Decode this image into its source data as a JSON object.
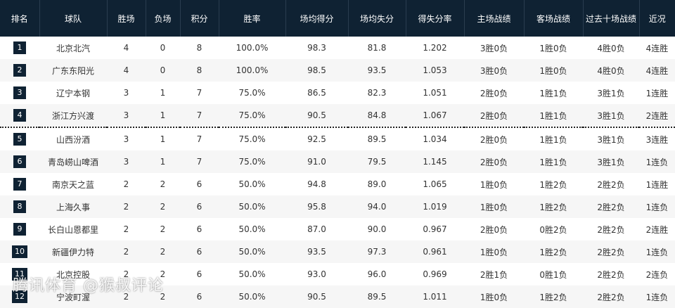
{
  "headers": [
    "排名",
    "球队",
    "胜场",
    "负场",
    "积分",
    "胜率",
    "场均得分",
    "场均失分",
    "得失分率",
    "主场战绩",
    "客场战绩",
    "过去十场战绩",
    "近况"
  ],
  "rows": [
    [
      "1",
      "北京北汽",
      "4",
      "0",
      "8",
      "100.0%",
      "98.3",
      "81.8",
      "1.202",
      "3胜0负",
      "1胜0负",
      "4胜0负",
      "4连胜"
    ],
    [
      "2",
      "广东东阳光",
      "4",
      "0",
      "8",
      "100.0%",
      "98.5",
      "93.5",
      "1.053",
      "3胜0负",
      "1胜0负",
      "4胜0负",
      "4连胜"
    ],
    [
      "3",
      "辽宁本钢",
      "3",
      "1",
      "7",
      "75.0%",
      "86.5",
      "82.3",
      "1.051",
      "2胜0负",
      "1胜1负",
      "3胜1负",
      "1连胜"
    ],
    [
      "4",
      "浙江方兴渡",
      "3",
      "1",
      "7",
      "75.0%",
      "90.5",
      "84.8",
      "1.067",
      "2胜0负",
      "1胜1负",
      "3胜1负",
      "2连胜"
    ],
    [
      "5",
      "山西汾酒",
      "3",
      "1",
      "7",
      "75.0%",
      "92.5",
      "89.5",
      "1.034",
      "2胜0负",
      "1胜1负",
      "3胜1负",
      "3连胜"
    ],
    [
      "6",
      "青岛崂山啤酒",
      "3",
      "1",
      "7",
      "75.0%",
      "91.0",
      "79.5",
      "1.145",
      "2胜0负",
      "1胜1负",
      "3胜1负",
      "1连负"
    ],
    [
      "7",
      "南京天之蓝",
      "2",
      "2",
      "6",
      "50.0%",
      "94.8",
      "89.0",
      "1.065",
      "1胜0负",
      "1胜2负",
      "2胜2负",
      "1连胜"
    ],
    [
      "8",
      "上海久事",
      "2",
      "2",
      "6",
      "50.0%",
      "95.8",
      "94.0",
      "1.019",
      "1胜0负",
      "1胜2负",
      "2胜2负",
      "1连负"
    ],
    [
      "9",
      "长白山恩都里",
      "2",
      "2",
      "6",
      "50.0%",
      "87.0",
      "90.0",
      "0.967",
      "2胜0负",
      "0胜2负",
      "2胜2负",
      "2连胜"
    ],
    [
      "10",
      "新疆伊力特",
      "2",
      "2",
      "6",
      "50.0%",
      "93.5",
      "97.3",
      "0.961",
      "1胜0负",
      "1胜2负",
      "2胜2负",
      "1连负"
    ],
    [
      "11",
      "北京控股",
      "2",
      "2",
      "6",
      "50.0%",
      "93.0",
      "96.0",
      "0.969",
      "2胜1负",
      "0胜1负",
      "2胜2负",
      "2连负"
    ],
    [
      "12",
      "宁波町渥",
      "2",
      "2",
      "6",
      "50.0%",
      "90.5",
      "89.5",
      "1.011",
      "1胜0负",
      "1胜2负",
      "2胜2负",
      "1连负"
    ]
  ],
  "watermark": "腾讯体育 @猴叔评论",
  "colors": {
    "header_bg": "#0f2233",
    "badge_bg": "#0f2233",
    "row_alt_bg": "#f6f6f6"
  }
}
